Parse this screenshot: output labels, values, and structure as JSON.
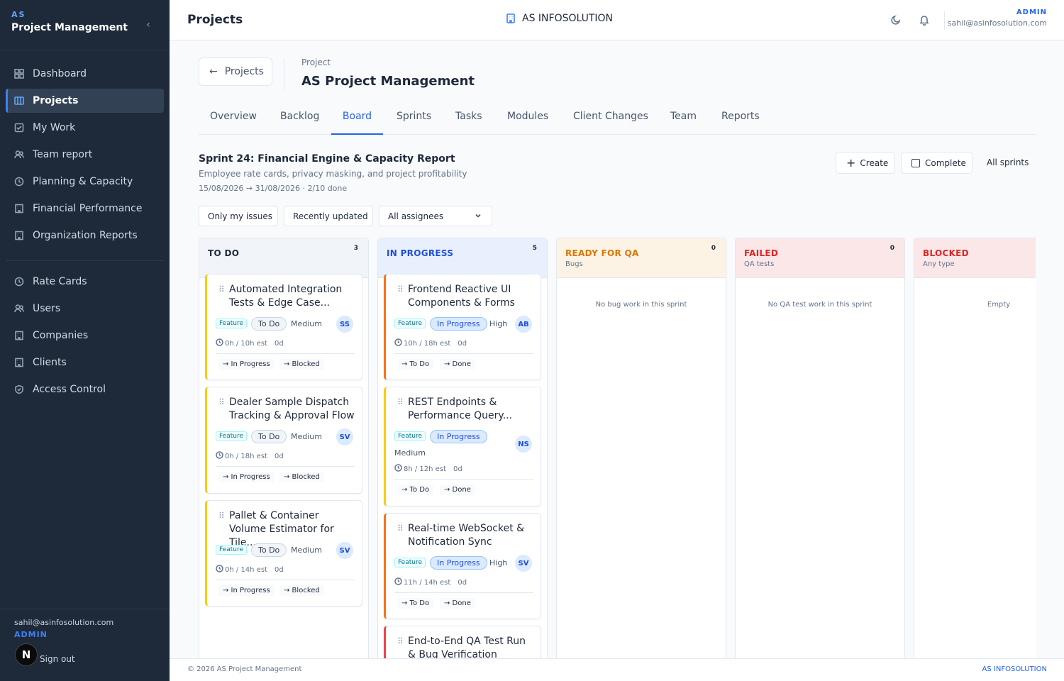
{
  "sidebar": {
    "brand_short": "AS",
    "brand_title": "Project Management",
    "nav_main": [
      {
        "label": "Dashboard",
        "icon": "dashboard-icon"
      },
      {
        "label": "Projects",
        "icon": "projects-icon",
        "active": true
      },
      {
        "label": "My Work",
        "icon": "check-square-icon"
      },
      {
        "label": "Team report",
        "icon": "users-icon"
      },
      {
        "label": "Planning & Capacity",
        "icon": "clock-icon"
      },
      {
        "label": "Financial Performance",
        "icon": "building-icon"
      },
      {
        "label": "Organization Reports",
        "icon": "building-icon"
      }
    ],
    "nav_admin": [
      {
        "label": "Rate Cards",
        "icon": "clock-icon"
      },
      {
        "label": "Users",
        "icon": "users-icon"
      },
      {
        "label": "Companies",
        "icon": "building-icon"
      },
      {
        "label": "Clients",
        "icon": "building-icon"
      },
      {
        "label": "Access Control",
        "icon": "shield-icon"
      }
    ],
    "user_email": "sahil@asinfosolution.com",
    "user_role": "ADMIN",
    "signout_label": "Sign out",
    "avatar_letter": "N"
  },
  "header": {
    "title": "Projects",
    "company": "AS INFOSOLUTION",
    "user_role": "ADMIN",
    "user_email": "sahil@asinfosolution.com"
  },
  "project": {
    "back_label": "Projects",
    "label": "Project",
    "name": "AS Project Management"
  },
  "tabs": [
    "Overview",
    "Backlog",
    "Board",
    "Sprints",
    "Tasks",
    "Modules",
    "Client Changes",
    "Team",
    "Reports"
  ],
  "active_tab": "Board",
  "sprint": {
    "title": "Sprint 24: Financial Engine & Capacity Report",
    "description": "Employee rate cards, privacy masking, and project profitability",
    "dates": "15/08/2026 → 31/08/2026 · 2/10 done",
    "create_label": "Create",
    "complete_label": "Complete",
    "all_sprints_label": "All sprints"
  },
  "filters": {
    "only_mine": "Only my issues",
    "recent": "Recently updated",
    "assignees": "All assignees"
  },
  "columns": [
    {
      "title": "TO DO",
      "subtitle": "",
      "count": "3",
      "color": "#1e293b",
      "bg": "#f1f5f9",
      "cards": [
        {
          "title": "Automated Integration Tests & Edge Case...",
          "tag": "Feature",
          "status": "To Do",
          "priority": "Medium",
          "assignee": "SS",
          "est": "0h / 10h est",
          "days": "0d",
          "move1": "→ In Progress",
          "move2": "→ Blocked"
        },
        {
          "title": "Dealer Sample Dispatch Tracking & Approval Flow",
          "tag": "Feature",
          "status": "To Do",
          "priority": "Medium",
          "assignee": "SV",
          "est": "0h / 18h est",
          "days": "0d",
          "move1": "→ In Progress",
          "move2": "→ Blocked"
        },
        {
          "title": "Pallet & Container Volume Estimator for Tile...",
          "tag": "Feature",
          "status": "To Do",
          "priority": "Medium",
          "assignee": "SV",
          "est": "0h / 14h est",
          "days": "0d",
          "move1": "→ In Progress",
          "move2": "→ Blocked"
        }
      ]
    },
    {
      "title": "IN PROGRESS",
      "subtitle": "",
      "count": "5",
      "color": "#1d4ed8",
      "bg": "#e8f0fe",
      "cards": [
        {
          "title": "Frontend Reactive UI Components & Forms",
          "tag": "Feature",
          "status": "In Progress",
          "priority": "High",
          "assignee": "AB",
          "est": "10h / 18h est",
          "days": "0d",
          "move1": "→ To Do",
          "move2": "→ Done"
        },
        {
          "title": "REST Endpoints & Performance Query...",
          "tag": "Feature",
          "status": "In Progress",
          "priority": "Medium",
          "assignee": "NS",
          "est": "8h / 12h est",
          "days": "0d",
          "move1": "→ To Do",
          "move2": "→ Done"
        },
        {
          "title": "Real-time WebSocket & Notification Sync",
          "tag": "Feature",
          "status": "In Progress",
          "priority": "High",
          "assignee": "SV",
          "est": "11h / 14h est",
          "days": "0d",
          "move1": "→ To Do",
          "move2": "→ Done"
        },
        {
          "title": "End-to-End QA Test Run & Bug Verification"
        }
      ]
    },
    {
      "title": "READY FOR QA",
      "subtitle": "Bugs",
      "count": "0",
      "color": "#d97706",
      "bg": "#fdf3e4",
      "empty": "No bug work in this sprint"
    },
    {
      "title": "FAILED",
      "subtitle": "QA tests",
      "count": "0",
      "color": "#dc2626",
      "bg": "#fbe7e7",
      "empty": "No QA test work in this sprint"
    },
    {
      "title": "BLOCKED",
      "subtitle": "Any type",
      "count": "",
      "color": "#dc2626",
      "bg": "#fbe7e7",
      "empty": "Empty"
    }
  ],
  "footer": {
    "copyright": "© 2026 AS Project Management",
    "brand": "AS INFOSOLUTION"
  }
}
